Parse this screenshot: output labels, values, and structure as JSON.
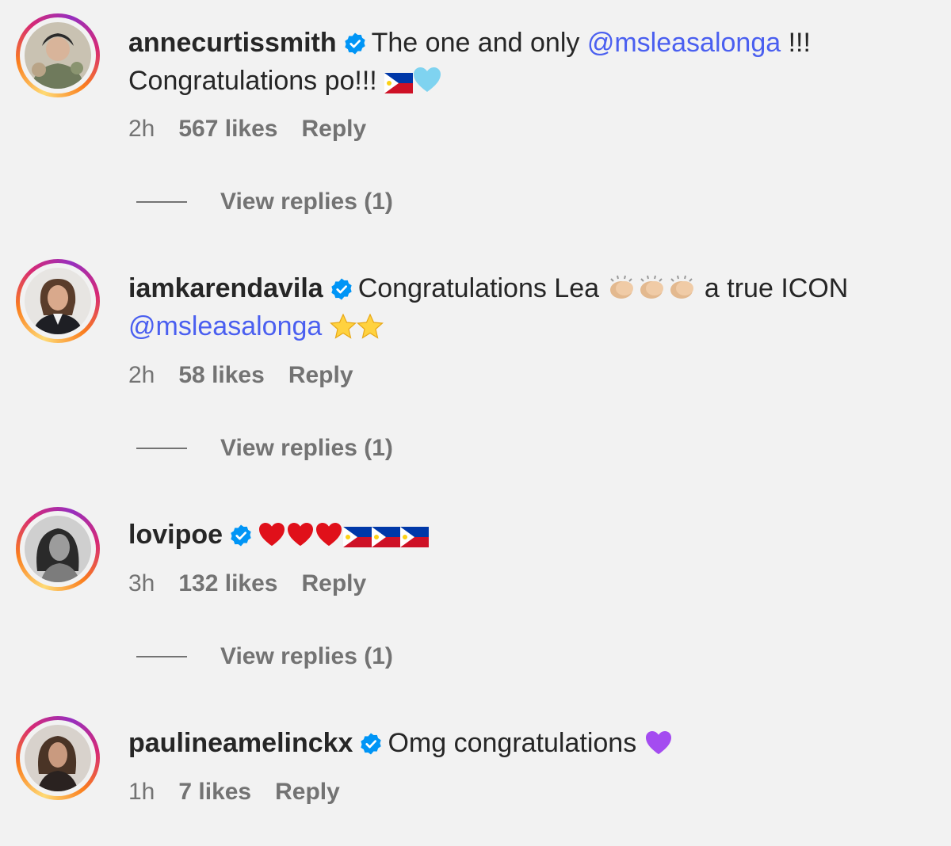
{
  "comments": [
    {
      "username": "annecurtissmith",
      "text_before": "The one and only ",
      "mention": "@msleasalonga",
      "text_after": " !!! Congratulations po!!! ",
      "time": "2h",
      "likes": "567 likes",
      "reply": "Reply",
      "view_replies": "View replies (1)"
    },
    {
      "username": "iamkarendavila",
      "text_before": "Congratulations Lea ",
      "text_mid": " a true ICON",
      "mention": "@msleasalonga",
      "time": "2h",
      "likes": "58 likes",
      "reply": "Reply",
      "view_replies": "View replies (1)"
    },
    {
      "username": "lovipoe",
      "time": "3h",
      "likes": "132 likes",
      "reply": "Reply",
      "view_replies": "View replies (1)"
    },
    {
      "username": "paulineamelinckx",
      "text_before": "Omg congratulations ",
      "time": "1h",
      "likes": "7 likes",
      "reply": "Reply"
    }
  ],
  "colors": {
    "mention": "#4a5ff0",
    "verified": "#0095f6",
    "muted": "#737373"
  },
  "icons": [
    "verified-badge-icon",
    "philippine-flag-icon",
    "light-blue-heart-icon",
    "clapping-hands-icon",
    "star-icon",
    "red-heart-icon",
    "purple-heart-icon"
  ]
}
